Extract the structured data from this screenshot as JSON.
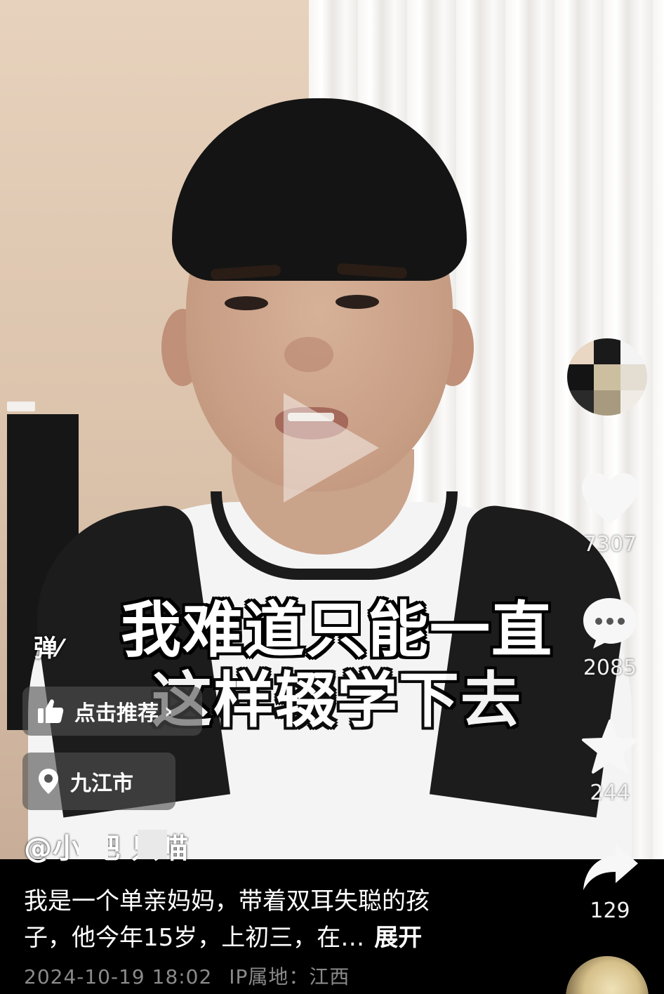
{
  "video": {
    "caption_line1": "我难道只能一直",
    "caption_line2": "这样辍学下去",
    "danmu_label": "弹",
    "play_icon": "play-icon"
  },
  "recommend": {
    "label": "点击推荐",
    "icon": "thumbs-up-icon",
    "chevron": "›"
  },
  "location": {
    "label": "九江市",
    "icon": "location-pin-icon"
  },
  "author": {
    "handle": "@小 吧 只喵"
  },
  "sidebar": {
    "likes": "7307",
    "comments": "2085",
    "favorites": "244",
    "shares": "129"
  },
  "description": {
    "text_line1": "我是一个单亲妈妈，带着双耳失聪的孩",
    "text_line2": "子，他今年15岁，上初三，在…",
    "expand_label": "展开"
  },
  "meta": {
    "datetime": "2024-10-19 18:02",
    "ip_label": "IP属地：江西"
  },
  "colors": {
    "overlay_pill": "#505050",
    "meta_text": "#8a8a8a",
    "background": "#000000"
  }
}
